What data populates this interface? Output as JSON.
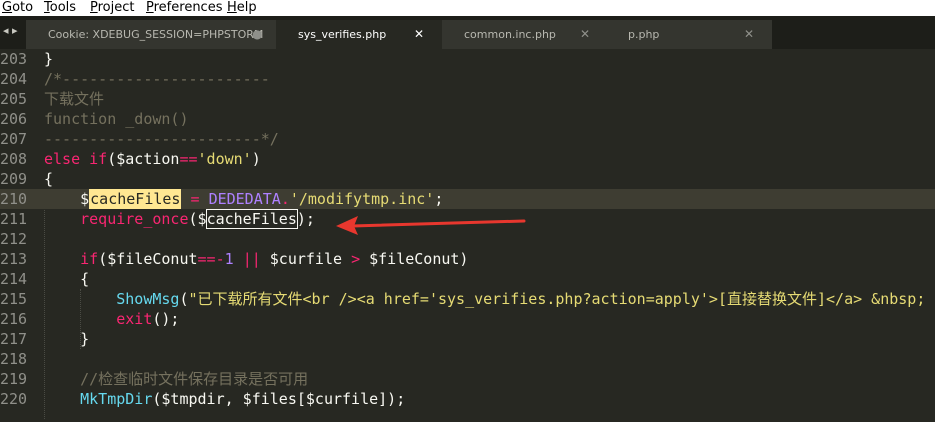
{
  "menu": [
    "Goto",
    "Tools",
    "Project",
    "Preferences",
    "Help"
  ],
  "tabs": [
    {
      "label": "Cookie: XDEBUG_SESSION=PHPSTORM",
      "control": "●",
      "active": false
    },
    {
      "label": "sys_verifies.php",
      "control": "✕",
      "active": true
    },
    {
      "label": "common.inc.php",
      "control": "✕",
      "active": false
    },
    {
      "label": "p.php",
      "control": "✕",
      "active": false
    }
  ],
  "tab_scroll": "◂ ▸",
  "lines": [
    {
      "n": "203",
      "parts": [
        {
          "t": "}",
          "c": "var"
        }
      ]
    },
    {
      "n": "204",
      "parts": [
        {
          "t": "/*-----------------------",
          "c": "cm"
        }
      ]
    },
    {
      "n": "205",
      "parts": [
        {
          "t": "下载文件",
          "c": "cm"
        }
      ]
    },
    {
      "n": "206",
      "parts": [
        {
          "t": "function _down()",
          "c": "cm"
        }
      ]
    },
    {
      "n": "207",
      "parts": [
        {
          "t": "------------------------*/",
          "c": "cm"
        }
      ]
    },
    {
      "n": "208",
      "parts": [
        {
          "t": "else ",
          "c": "kw"
        },
        {
          "t": "if",
          "c": "kw"
        },
        {
          "t": "(",
          "c": "var"
        },
        {
          "t": "$action",
          "c": "var"
        },
        {
          "t": "==",
          "c": "kw"
        },
        {
          "t": "'down'",
          "c": "str"
        },
        {
          "t": ")",
          "c": "var"
        }
      ]
    },
    {
      "n": "209",
      "parts": [
        {
          "t": "{",
          "c": "var"
        }
      ]
    },
    {
      "n": "210",
      "hl": true,
      "parts": [
        {
          "t": "    $",
          "c": "var"
        },
        {
          "t": "cacheFiles",
          "c": "sel"
        },
        {
          "t": " ",
          "c": "var"
        },
        {
          "t": "=",
          "c": "kw"
        },
        {
          "t": " ",
          "c": "var"
        },
        {
          "t": "DEDEDATA",
          "c": "num"
        },
        {
          "t": ".",
          "c": "kw"
        },
        {
          "t": "'/modifytmp.inc'",
          "c": "str"
        },
        {
          "t": ";",
          "c": "var"
        }
      ]
    },
    {
      "n": "211",
      "parts": [
        {
          "t": "    require_once",
          "c": "kw"
        },
        {
          "t": "($",
          "c": "var"
        },
        {
          "t": "cacheFiles",
          "c": "box"
        },
        {
          "t": ");",
          "c": "var"
        }
      ]
    },
    {
      "n": "212",
      "parts": [
        {
          "t": "",
          "c": "var"
        }
      ]
    },
    {
      "n": "213",
      "parts": [
        {
          "t": "    if",
          "c": "kw"
        },
        {
          "t": "($fileConut",
          "c": "var"
        },
        {
          "t": "==-",
          "c": "kw"
        },
        {
          "t": "1",
          "c": "num"
        },
        {
          "t": " ",
          "c": "var"
        },
        {
          "t": "||",
          "c": "kw"
        },
        {
          "t": " $curfile ",
          "c": "var"
        },
        {
          "t": ">",
          "c": "kw"
        },
        {
          "t": " $fileConut)",
          "c": "var"
        }
      ]
    },
    {
      "n": "214",
      "parts": [
        {
          "t": "    {",
          "c": "var"
        }
      ]
    },
    {
      "n": "215",
      "parts": [
        {
          "t": "        ",
          "c": "var"
        },
        {
          "t": "ShowMsg",
          "c": "fn"
        },
        {
          "t": "(",
          "c": "var"
        },
        {
          "t": "\"已下载所有文件<br /><a href='sys_verifies.php?action=apply'>[直接替换文件]</a> &nbsp;",
          "c": "str"
        }
      ]
    },
    {
      "n": "216",
      "parts": [
        {
          "t": "        ",
          "c": "var"
        },
        {
          "t": "exit",
          "c": "kw"
        },
        {
          "t": "();",
          "c": "var"
        }
      ]
    },
    {
      "n": "217",
      "parts": [
        {
          "t": "    }",
          "c": "var"
        }
      ]
    },
    {
      "n": "218",
      "parts": [
        {
          "t": "",
          "c": "var"
        }
      ]
    },
    {
      "n": "219",
      "parts": [
        {
          "t": "    //检查临时文件保存目录是否可用",
          "c": "cm"
        }
      ]
    },
    {
      "n": "220",
      "parts": [
        {
          "t": "    ",
          "c": "var"
        },
        {
          "t": "MkTmpDir",
          "c": "fn"
        },
        {
          "t": "($tmpdir, $files[$curfile]);",
          "c": "var"
        }
      ]
    }
  ],
  "colors": {
    "accent": "#ff3b30",
    "background": "#272822",
    "selection": "#ffe792"
  }
}
